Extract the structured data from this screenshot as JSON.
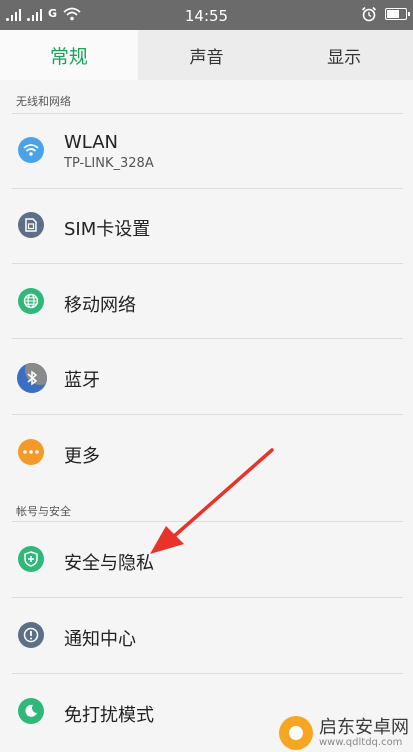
{
  "status_bar": {
    "network": "G",
    "time": "14:55"
  },
  "tabs": [
    {
      "label": "常规",
      "active": true
    },
    {
      "label": "声音",
      "active": false
    },
    {
      "label": "显示",
      "active": false
    }
  ],
  "sections": {
    "network": {
      "header": "无线和网络"
    },
    "account": {
      "header": "帐号与安全"
    }
  },
  "items": {
    "wlan": {
      "label": "WLAN",
      "subtitle": "TP-LINK_328A",
      "icon": "wifi-icon",
      "color": "#4aa3e8"
    },
    "sim": {
      "label": "SIM卡设置",
      "icon": "sim-card-icon",
      "color": "#5d6f86"
    },
    "mobile": {
      "label": "移动网络",
      "icon": "globe-icon",
      "color": "#2fb87a"
    },
    "bluetooth": {
      "label": "蓝牙",
      "icon": "bluetooth-icon",
      "color": "#3a6fc4"
    },
    "more": {
      "label": "更多",
      "icon": "more-icon",
      "color": "#f39a2a"
    },
    "security": {
      "label": "安全与隐私",
      "icon": "shield-icon",
      "color": "#2fb87a"
    },
    "notification": {
      "label": "通知中心",
      "icon": "alert-icon",
      "color": "#5d6f86"
    },
    "dnd": {
      "label": "免打扰模式",
      "icon": "moon-icon",
      "color": "#2fb87a"
    }
  },
  "watermark": {
    "title": "启东安卓网",
    "url": "www.qdltdq.com"
  },
  "annotation": {
    "type": "red-arrow",
    "points_to": "security",
    "color": "#e8322a"
  }
}
